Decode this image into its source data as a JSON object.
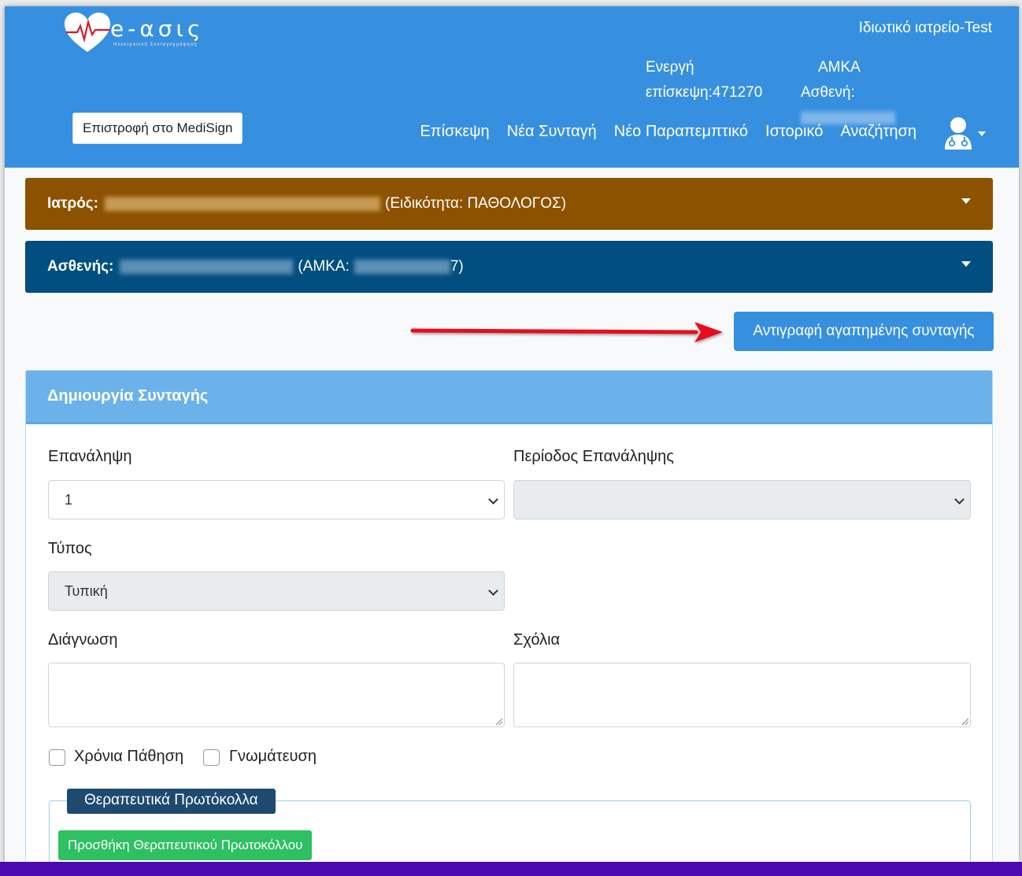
{
  "header": {
    "logo_text": "e-ασις",
    "logo_subtitle": "Ηλεκτρονική Συνταγογράφηση",
    "clinic_name": "Ιδιωτικό ιατρείο-Test",
    "active_visit_line1": "Ενεργή",
    "active_visit_line2": "επίσκεψη:471270",
    "amka_line1": "ΑΜΚΑ",
    "amka_line2": "Ασθενή:",
    "back_button": "Επιστροφή στο MediSign",
    "nav": [
      "Επίσκεψη",
      "Νέα Συνταγή",
      "Νέο Παραπεμπτικό",
      "Ιστορικό",
      "Αναζήτηση"
    ]
  },
  "doctor_bar": {
    "label": "Ιατρός:",
    "specialty": "(Ειδικότητα: ΠΑΘΟΛΟΓΟΣ)"
  },
  "patient_bar": {
    "label": "Ασθενής:",
    "amka_prefix": "(ΑΜΚΑ:",
    "amka_suffix": "7)"
  },
  "copy_button": "Αντιγραφή αγαπημένης συνταγής",
  "form": {
    "title": "Δημιουργία Συνταγής",
    "repeat_label": "Επανάληψη",
    "repeat_value": "1",
    "repeat_period_label": "Περίοδος Επανάληψης",
    "repeat_period_value": "",
    "type_label": "Τύπος",
    "type_value": "Τυπική",
    "diagnosis_label": "Διάγνωση",
    "comments_label": "Σχόλια",
    "chronic_label": "Χρόνια Πάθηση",
    "opinion_label": "Γνωμάτευση",
    "protocols_legend": "Θεραπευτικά Πρωτόκολλα",
    "add_protocol_button": "Προσθήκη Θεραπευτικού Πρωτοκόλλου"
  },
  "colors": {
    "header": "#3690df",
    "doctor_bar": "#8c5200",
    "patient_bar": "#004f80",
    "panel_header": "#6cb2ea",
    "add_button": "#2ec061",
    "arrow": "#e8111b"
  }
}
